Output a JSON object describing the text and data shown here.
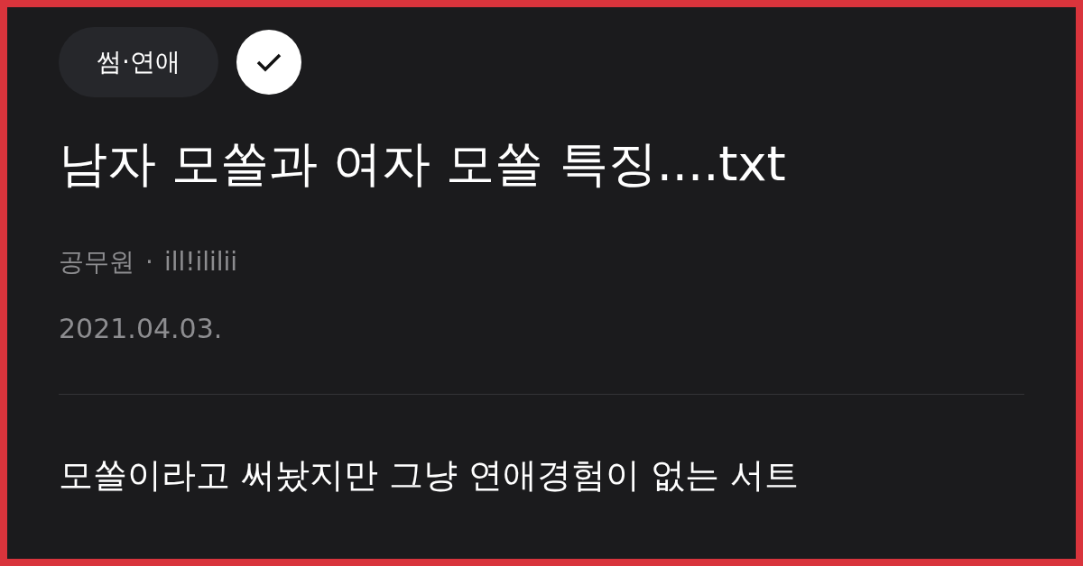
{
  "category": {
    "label": "썸·연애",
    "checked": true
  },
  "post": {
    "title": "남자 모쏠과 여자 모쏠 특징....txt",
    "company": "공무원",
    "separator": "·",
    "author": "ill!ililii",
    "date": "2021.04.03.",
    "body": "모쏠이라고 써놨지만 그냥 연애경험이 없는 서트"
  }
}
